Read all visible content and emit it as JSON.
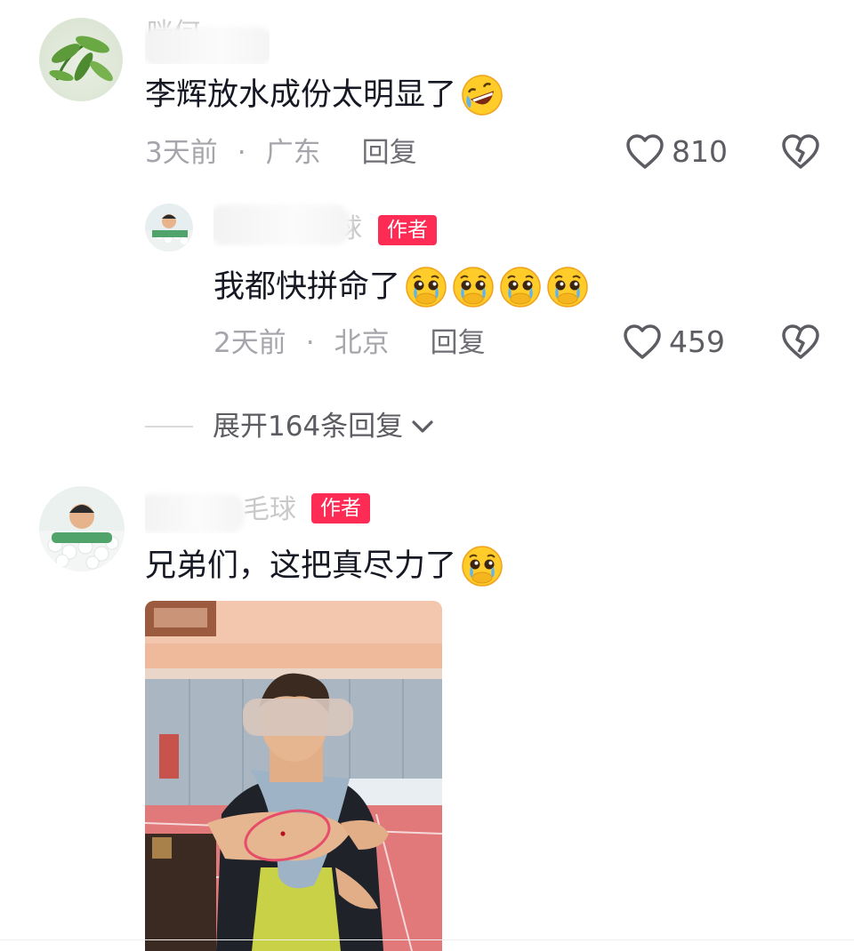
{
  "comments": [
    {
      "author": "咪何",
      "text": "李辉放水成份太明显了",
      "emoji": "rofl-emoji",
      "time": "3天前",
      "dot": "·",
      "location": "广东",
      "reply_label": "回复",
      "likes": "810",
      "replies": [
        {
          "author_visible": "毛球",
          "badge": "作者",
          "text": "我都快拼命了",
          "emoji": "pleading-crying-emoji",
          "emoji_count": 4,
          "time": "2天前",
          "dot": "·",
          "location": "北京",
          "reply_label": "回复",
          "likes": "459"
        }
      ],
      "expand_label": "展开164条回复"
    },
    {
      "author_visible": "毛球",
      "badge": "作者",
      "text": "兄弟们，这把真尽力了",
      "emoji": "pleading-crying-emoji",
      "image": "photo-man-showing-bruised-elbow"
    }
  ],
  "colors": {
    "badge": "#fe2c55",
    "text": "#161823",
    "meta": "#a5a5ab"
  }
}
